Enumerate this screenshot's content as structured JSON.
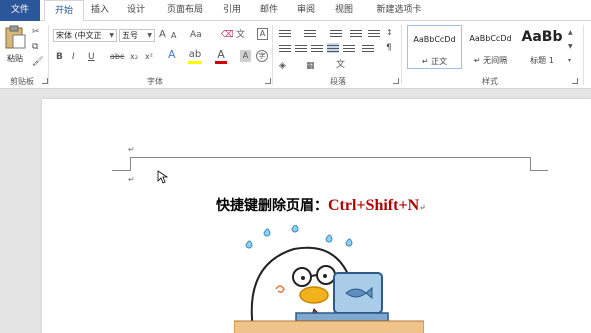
{
  "tabs": [
    "文件",
    "开始",
    "插入",
    "设计",
    "页面布局",
    "引用",
    "邮件",
    "审阅",
    "视图",
    "新建选项卡"
  ],
  "clipboard": {
    "paste_label": "粘贴",
    "group_label": "剪贴板"
  },
  "font": {
    "family_value": "宋体 (中文正",
    "size_value": "五号",
    "group_label": "字体",
    "bold": "B",
    "italic": "I",
    "underline": "U",
    "strike": "abc",
    "sub": "x₂",
    "sup": "x²",
    "font_color": "A",
    "grow": "A",
    "shrink": "A",
    "case": "Aa"
  },
  "paragraph": {
    "group_label": "段落"
  },
  "styles": {
    "group_label": "样式",
    "items": [
      {
        "sample": "AaBbCcDd",
        "name": "↵ 正文"
      },
      {
        "sample": "AaBbCcDd",
        "name": "↵ 无间隔"
      },
      {
        "sample": "AaBb",
        "name": "标题 1"
      }
    ]
  },
  "document": {
    "heading_cn": "快捷键删除页眉：",
    "heading_shortcut": "Ctrl+Shift+N",
    "para_mark": "↵"
  },
  "colors": {
    "accent": "#2b579a",
    "shortcut_red": "#b00000",
    "highlight_yellow": "#ffff00",
    "font_red": "#d00000"
  }
}
